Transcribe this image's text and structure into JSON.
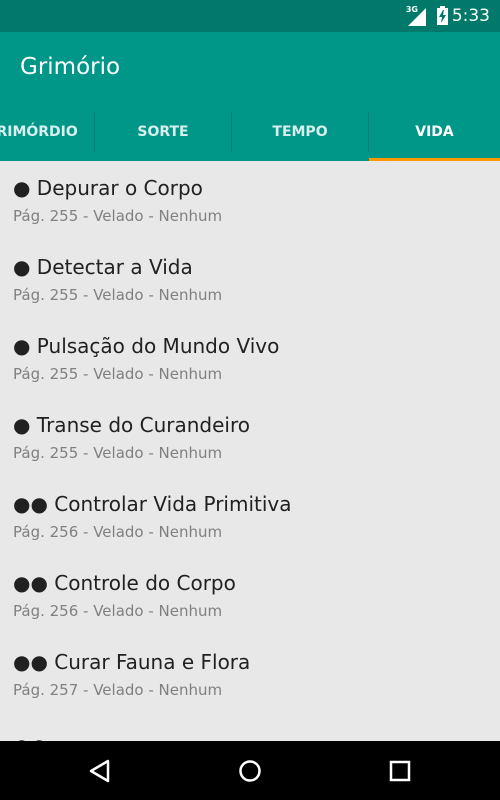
{
  "status_bar": {
    "network": "3G",
    "time": "5:33"
  },
  "app_bar": {
    "title": "Grimório"
  },
  "tabs": [
    {
      "label": "PRIMÓRDIO",
      "active": false
    },
    {
      "label": "SORTE",
      "active": false
    },
    {
      "label": "TEMPO",
      "active": false
    },
    {
      "label": "VIDA",
      "active": true
    }
  ],
  "list": {
    "items": [
      {
        "title": "● Depurar o Corpo",
        "subtitle": "Pág. 255 - Velado - Nenhum"
      },
      {
        "title": "● Detectar a Vida",
        "subtitle": "Pág. 255 - Velado - Nenhum"
      },
      {
        "title": "● Pulsação do Mundo Vivo",
        "subtitle": "Pág. 255 - Velado - Nenhum"
      },
      {
        "title": "● Transe do Curandeiro",
        "subtitle": "Pág. 255 - Velado - Nenhum"
      },
      {
        "title": "●● Controlar Vida Primitiva",
        "subtitle": "Pág. 256 - Velado - Nenhum"
      },
      {
        "title": "●● Controle do Corpo",
        "subtitle": "Pág. 256 - Velado - Nenhum"
      },
      {
        "title": "●● Curar Fauna e Flora",
        "subtitle": "Pág. 257 - Velado - Nenhum"
      }
    ]
  },
  "nav_bar": {
    "icons": [
      "back-icon",
      "home-icon",
      "recents-icon"
    ]
  },
  "colors": {
    "primary": "#009688",
    "primary_dark": "#00796b",
    "accent": "#ff9800",
    "background": "#e8e8e8"
  }
}
